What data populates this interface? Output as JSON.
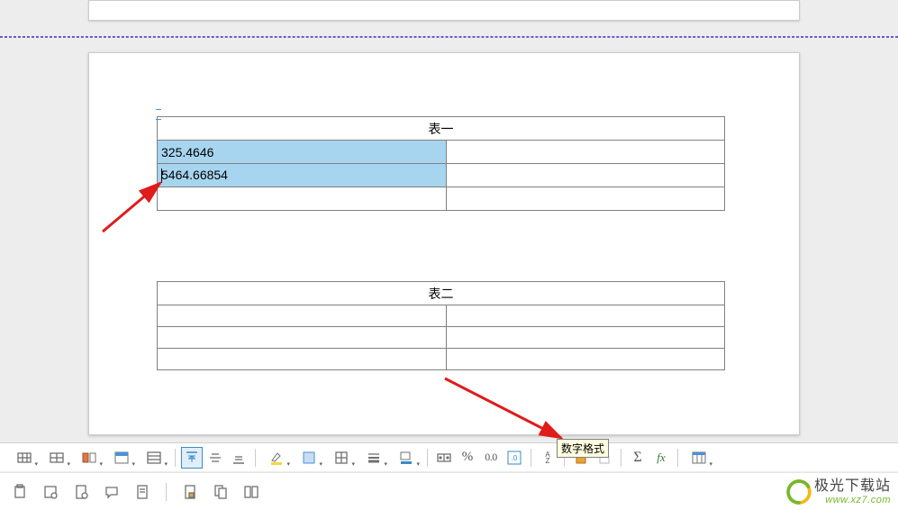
{
  "tables": {
    "table1": {
      "title": "表一",
      "rows": [
        [
          "325.4646",
          ""
        ],
        [
          "5464.66854",
          ""
        ],
        [
          "",
          ""
        ]
      ]
    },
    "table2": {
      "title": "表二",
      "rows": [
        [
          "",
          ""
        ],
        [
          "",
          ""
        ],
        [
          "",
          ""
        ]
      ]
    }
  },
  "tooltip": {
    "number_format": "数字格式"
  },
  "toolbar1": {
    "items": [
      "insert-row",
      "delete-row",
      "split-cell",
      "select-table",
      "table-props",
      "sep",
      "align-top",
      "align-middle",
      "align-bottom",
      "sep",
      "highlight",
      "border-style",
      "borders",
      "line-style",
      "fill-color",
      "sep",
      "autofit",
      "percent",
      "decimal",
      "number-format",
      "sep2",
      "sort",
      "sep",
      "lock",
      "unlock",
      "sep",
      "sum",
      "formula",
      "sep",
      "table-wizard"
    ],
    "labels": {
      "percent": "%",
      "decimal": "0.0",
      "sort": "A\nZ",
      "sum": "Σ",
      "formula": "fx"
    }
  },
  "toolbar2": {
    "items": [
      "paste",
      "obj-props",
      "doc-info",
      "comment",
      "notes",
      "sep",
      "protect-doc",
      "copy-doc",
      "compare"
    ]
  },
  "watermark": {
    "name": "极光下载站",
    "url": "www.xz7.com"
  }
}
